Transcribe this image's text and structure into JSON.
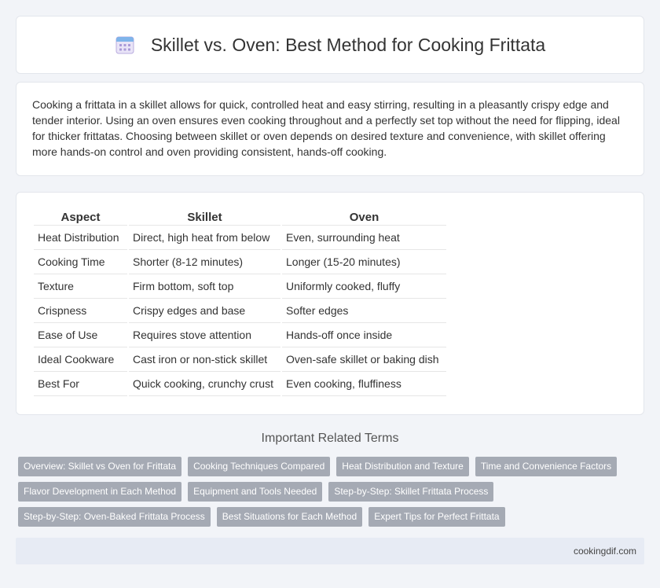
{
  "header": {
    "title": "Skillet vs. Oven: Best Method for Cooking Frittata",
    "icon": "calendar-icon"
  },
  "intro": {
    "text": "Cooking a frittata in a skillet allows for quick, controlled heat and easy stirring, resulting in a pleasantly crispy edge and tender interior. Using an oven ensures even cooking throughout and a perfectly set top without the need for flipping, ideal for thicker frittatas. Choosing between skillet or oven depends on desired texture and convenience, with skillet offering more hands-on control and oven providing consistent, hands-off cooking."
  },
  "table": {
    "headers": [
      "Aspect",
      "Skillet",
      "Oven"
    ],
    "rows": [
      [
        "Heat Distribution",
        "Direct, high heat from below",
        "Even, surrounding heat"
      ],
      [
        "Cooking Time",
        "Shorter (8-12 minutes)",
        "Longer (15-20 minutes)"
      ],
      [
        "Texture",
        "Firm bottom, soft top",
        "Uniformly cooked, fluffy"
      ],
      [
        "Crispness",
        "Crispy edges and base",
        "Softer edges"
      ],
      [
        "Ease of Use",
        "Requires stove attention",
        "Hands-off once inside"
      ],
      [
        "Ideal Cookware",
        "Cast iron or non-stick skillet",
        "Oven-safe skillet or baking dish"
      ],
      [
        "Best For",
        "Quick cooking, crunchy crust",
        "Even cooking, fluffiness"
      ]
    ]
  },
  "related": {
    "title": "Important Related Terms",
    "tags": [
      "Overview: Skillet vs Oven for Frittata",
      "Cooking Techniques Compared",
      "Heat Distribution and Texture",
      "Time and Convenience Factors",
      "Flavor Development in Each Method",
      "Equipment and Tools Needed",
      "Step-by-Step: Skillet Frittata Process",
      "Step-by-Step: Oven-Baked Frittata Process",
      "Best Situations for Each Method",
      "Expert Tips for Perfect Frittata"
    ]
  },
  "footer": {
    "site": "cookingdif.com"
  }
}
